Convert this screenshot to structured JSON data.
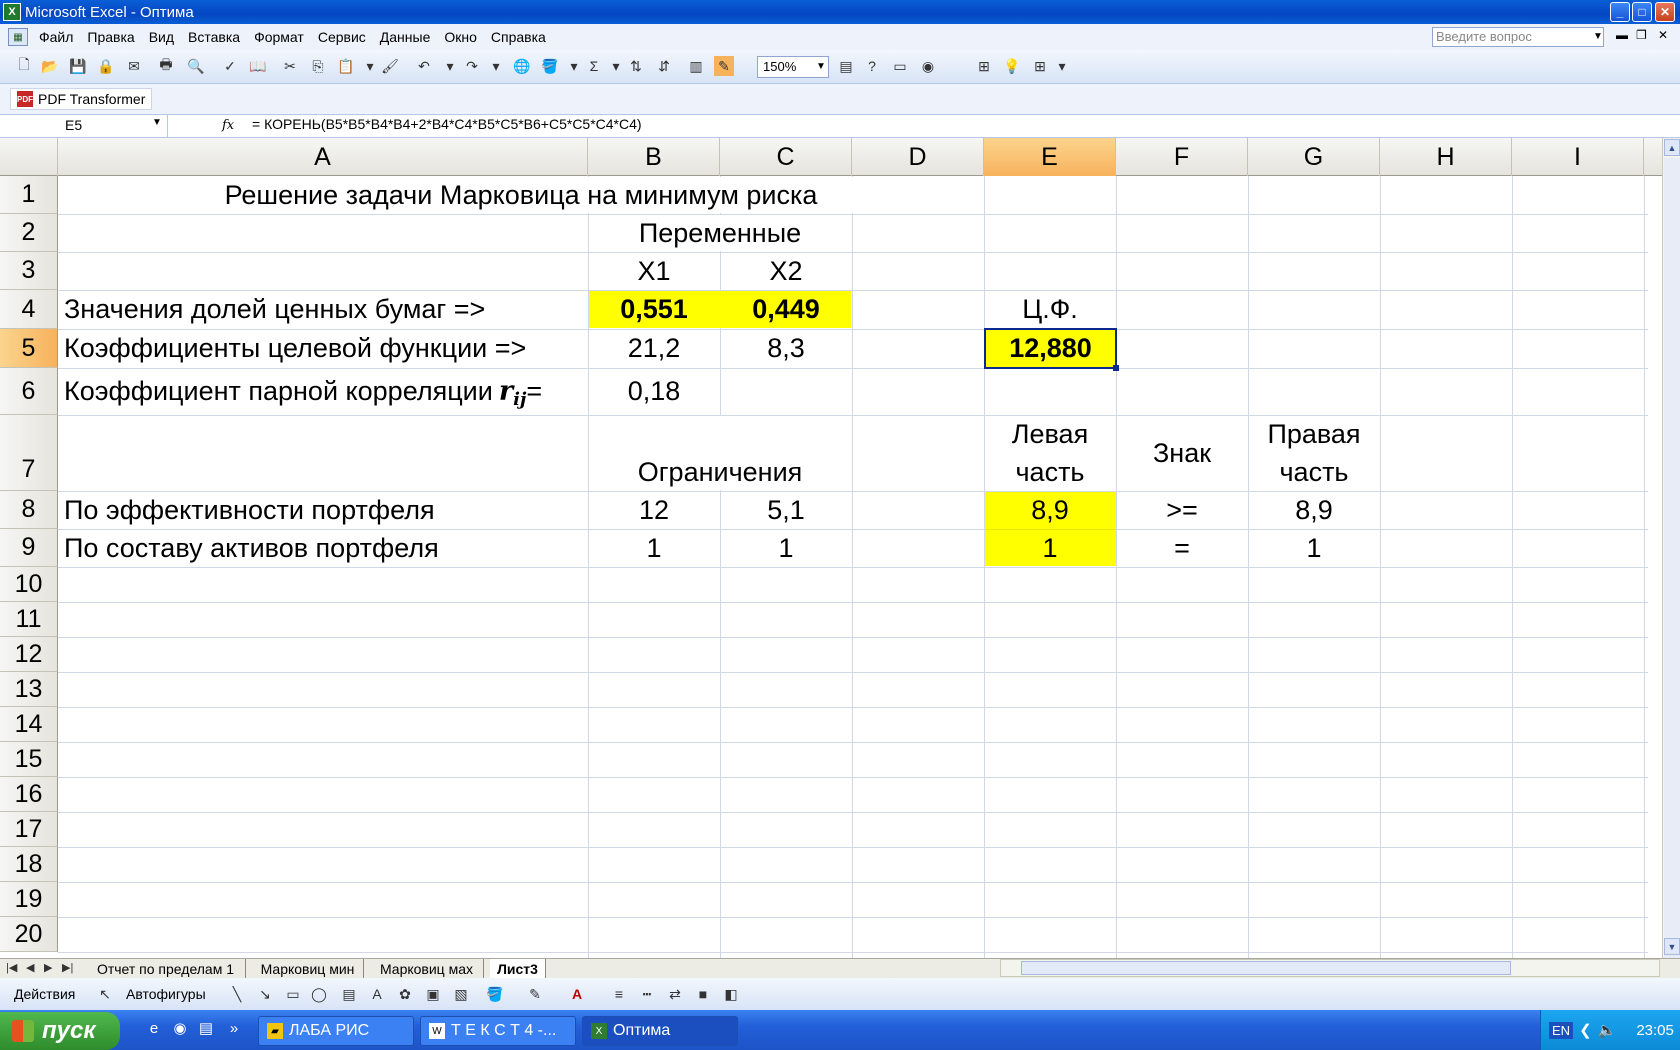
{
  "window": {
    "title": "Microsoft Excel - Оптима",
    "app_icon_letter": "X",
    "buttons": {
      "minimize": "_",
      "maximize": "□",
      "close": "✕"
    },
    "doc_controls": {
      "minimize": "▬",
      "restore": "❐",
      "close": "✕"
    }
  },
  "menu": {
    "items": [
      "Файл",
      "Правка",
      "Вид",
      "Вставка",
      "Формат",
      "Сервис",
      "Данные",
      "Окно",
      "Справка"
    ],
    "help_placeholder": "Введите вопрос"
  },
  "toolbar": {
    "zoom": "150%",
    "icons": [
      "new-icon",
      "open-icon",
      "save-icon",
      "permission-icon",
      "print-icon",
      "print-preview-icon",
      "spelling-icon",
      "research-icon",
      "cut-icon",
      "copy-icon",
      "paste-icon",
      "format-painter-icon",
      "undo-icon",
      "redo-icon",
      "hyperlink-icon",
      "fill-icon",
      "autosum-icon",
      "sort-asc-icon",
      "sort-desc-icon",
      "chart-wizard-icon",
      "drawing-icon",
      "zoom-box",
      "pdf-icon",
      "help-icon",
      "borders-icon",
      "lightbulb-icon",
      "grid-icon"
    ],
    "pdf_transformer": "PDF Transformer"
  },
  "formula_bar": {
    "name_box": "E5",
    "fx": "fx",
    "formula": "= КОРЕНЬ(B5*B5*B4*B4+2*B4*C4*B5*C5*B6+C5*C5*C4*C4)"
  },
  "grid": {
    "columns": [
      "A",
      "B",
      "C",
      "D",
      "E",
      "F",
      "G",
      "H",
      "I"
    ],
    "active_column": "E",
    "rows": [
      "1",
      "2",
      "3",
      "4",
      "5",
      "6",
      "7",
      "8",
      "9",
      "10",
      "11",
      "12",
      "13",
      "14",
      "15",
      "16",
      "17",
      "18",
      "19",
      "20"
    ],
    "active_row": "5",
    "cells": {
      "A1": "Решение задачи Марковица на минимум риска",
      "B2": "Переменные",
      "B3": "X1",
      "C3": "X2",
      "A4": "Значения долей ценных бумаг =>",
      "B4": "0,551",
      "C4": "0,449",
      "E4": "Ц.Ф.",
      "A5": "Коэффициенты целевой функции =>",
      "B5": "21,2",
      "C5": "8,3",
      "E5": "12,880",
      "A6": "Коэффициент парной корреляции ",
      "A6_r": "r",
      "A6_sub": "ij",
      "A6_eq": "=",
      "B6": "0,18",
      "E7_line1": "Левая",
      "E7_line2": "часть",
      "F7": "Знак",
      "G7_line1": "Правая",
      "G7_line2": "часть",
      "B7": "Ограничения",
      "A8": "По эффективности портфеля",
      "B8": "12",
      "C8": "5,1",
      "E8": "8,9",
      "F8": ">=",
      "G8": "8,9",
      "A9": "По составу активов портфеля",
      "B9": "1",
      "C9": "1",
      "E9": "1",
      "F9": "=",
      "G9": "1"
    },
    "highlight_color": "#ffff00"
  },
  "sheets": {
    "tabs": [
      "Отчет по пределам 1",
      "Марковиц мин",
      "Марковиц мах",
      "Лист3"
    ],
    "active": "Лист3"
  },
  "drawing_toolbar": {
    "actions": "Действия",
    "autoshapes": "Автофигуры"
  },
  "taskbar": {
    "start": "пуск",
    "buttons": [
      "ЛАБА РИС",
      "Т Е К С Т 4 -...",
      "Оптима"
    ],
    "active": "Оптима",
    "lang": "EN",
    "clock": "23:05"
  }
}
